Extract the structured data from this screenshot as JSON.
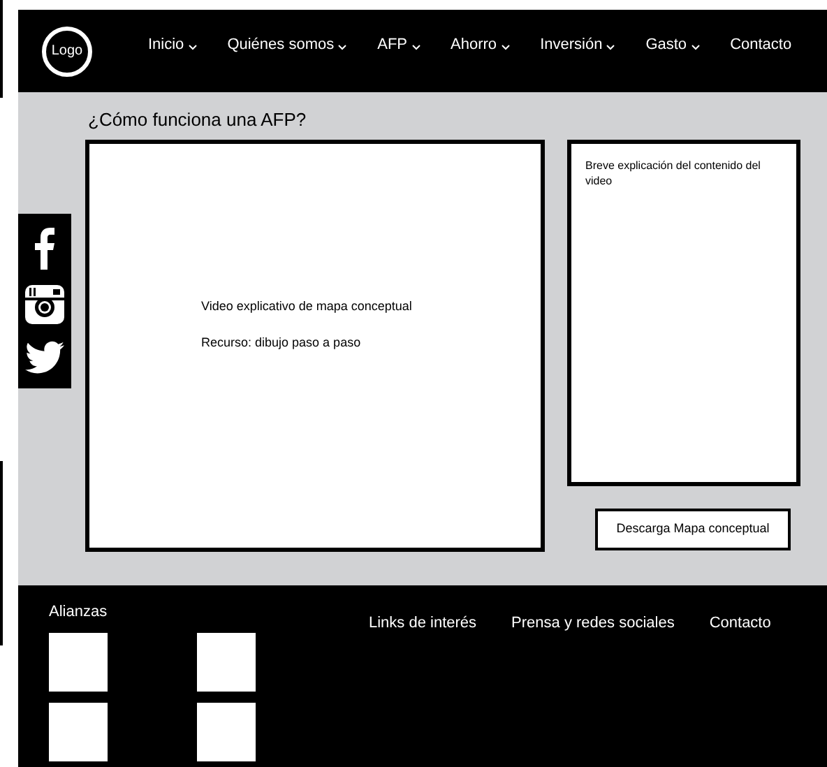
{
  "header": {
    "logo": "Logo",
    "nav": [
      {
        "label": "Inicio",
        "dropdown": true
      },
      {
        "label": "Quiénes somos",
        "dropdown": true
      },
      {
        "label": "AFP",
        "dropdown": true
      },
      {
        "label": "Ahorro",
        "dropdown": true
      },
      {
        "label": "Inversión",
        "dropdown": true
      },
      {
        "label": "Gasto",
        "dropdown": true
      },
      {
        "label": "Contacto",
        "dropdown": false
      }
    ]
  },
  "page_title": "¿Cómo funciona una AFP?",
  "social": [
    {
      "kind": "facebook"
    },
    {
      "kind": "instagram"
    },
    {
      "kind": "twitter"
    }
  ],
  "video": {
    "lines": [
      "Video explicativo de mapa conceptual",
      "Recurso: dibujo paso a paso"
    ]
  },
  "description": "Breve explicación del contenido del video",
  "download_button": "Descarga Mapa conceptual",
  "footer": {
    "alliances_title": "Alianzas",
    "alliance_logos": [
      {
        "kind": "placeholder"
      },
      {
        "kind": "placeholder"
      },
      {
        "kind": "placeholder"
      },
      {
        "kind": "placeholder"
      }
    ],
    "links": [
      "Links de interés",
      "Prensa y redes sociales",
      "Contacto"
    ]
  }
}
